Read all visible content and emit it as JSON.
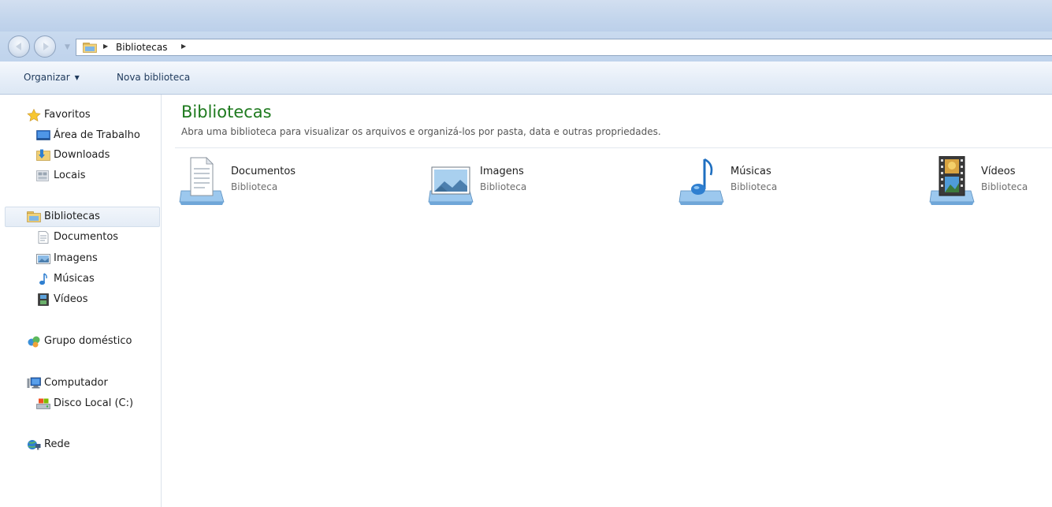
{
  "navigation": {
    "breadcrumb": [
      "Bibliotecas"
    ]
  },
  "toolbar": {
    "organize_label": "Organizar",
    "new_library_label": "Nova biblioteca"
  },
  "sidebar": {
    "favorites": {
      "label": "Favoritos",
      "items": [
        {
          "label": "Área de Trabalho",
          "icon": "desktop-icon"
        },
        {
          "label": "Downloads",
          "icon": "downloads-folder-icon"
        },
        {
          "label": "Locais",
          "icon": "recent-places-icon"
        }
      ]
    },
    "libraries": {
      "label": "Bibliotecas",
      "selected": true,
      "items": [
        {
          "label": "Documentos",
          "icon": "document-icon"
        },
        {
          "label": "Imagens",
          "icon": "picture-icon"
        },
        {
          "label": "Músicas",
          "icon": "music-note-icon"
        },
        {
          "label": "Vídeos",
          "icon": "film-icon"
        }
      ]
    },
    "homegroup": {
      "label": "Grupo doméstico"
    },
    "computer": {
      "label": "Computador",
      "items": [
        {
          "label": "Disco Local (C:)",
          "icon": "local-disk-icon"
        }
      ]
    },
    "network": {
      "label": "Rede"
    }
  },
  "content": {
    "title": "Bibliotecas",
    "description": "Abra uma biblioteca para visualizar os arquivos e organizá-los por pasta, data e outras propriedades.",
    "libraries": [
      {
        "name": "Documentos",
        "type": "Biblioteca",
        "icon": "documents-library-icon"
      },
      {
        "name": "Imagens",
        "type": "Biblioteca",
        "icon": "pictures-library-icon"
      },
      {
        "name": "Músicas",
        "type": "Biblioteca",
        "icon": "music-library-icon"
      },
      {
        "name": "Vídeos",
        "type": "Biblioteca",
        "icon": "videos-library-icon"
      }
    ]
  },
  "colors": {
    "title_green": "#1e7a1e",
    "chrome_blue": "#c3d5ec",
    "selection": "#e4ecf6"
  }
}
